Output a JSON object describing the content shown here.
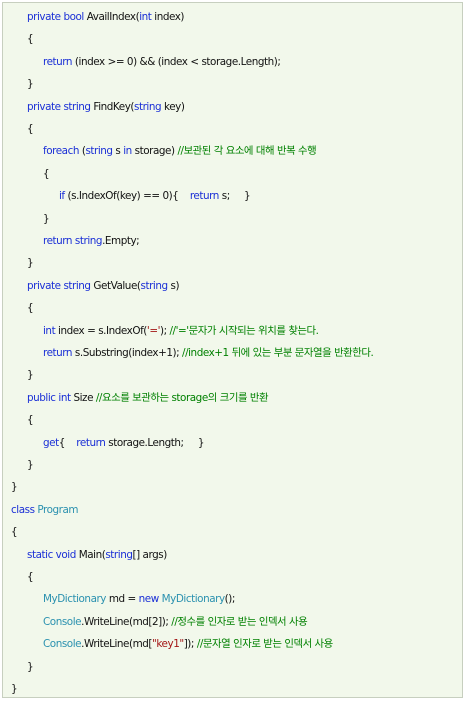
{
  "colors": {
    "background": "#f2f8eb",
    "keyword": "#1a2fd6",
    "type_name": "#2b91af",
    "string_literal": "#a31515",
    "comment": "#008000",
    "text": "#111111"
  },
  "lines": [
    {
      "indent": 1,
      "tokens": [
        {
          "c": "kw",
          "t": "private bool"
        },
        {
          "c": "txt",
          "t": " AvailIndex("
        },
        {
          "c": "kw",
          "t": "int"
        },
        {
          "c": "txt",
          "t": " index)"
        }
      ]
    },
    {
      "indent": 1,
      "tokens": [
        {
          "c": "txt",
          "t": "{"
        }
      ]
    },
    {
      "indent": 2,
      "tokens": [
        {
          "c": "kw",
          "t": "return"
        },
        {
          "c": "txt",
          "t": " (index >= 0) && (index < storage.Length);"
        }
      ]
    },
    {
      "indent": 1,
      "tokens": [
        {
          "c": "txt",
          "t": "}"
        }
      ]
    },
    {
      "indent": 1,
      "tokens": [
        {
          "c": "kw",
          "t": "private string"
        },
        {
          "c": "txt",
          "t": " FindKey("
        },
        {
          "c": "kw",
          "t": "string"
        },
        {
          "c": "txt",
          "t": " key)"
        }
      ]
    },
    {
      "indent": 1,
      "tokens": [
        {
          "c": "txt",
          "t": "{"
        }
      ]
    },
    {
      "indent": 2,
      "tokens": [
        {
          "c": "kw",
          "t": "foreach"
        },
        {
          "c": "txt",
          "t": " ("
        },
        {
          "c": "kw",
          "t": "string"
        },
        {
          "c": "txt",
          "t": " s "
        },
        {
          "c": "kw",
          "t": "in"
        },
        {
          "c": "txt",
          "t": " storage) "
        },
        {
          "c": "cmt",
          "t": "//보관된 각 요소에 대해 반복 수행"
        }
      ]
    },
    {
      "indent": 2,
      "tokens": [
        {
          "c": "txt",
          "t": "{"
        }
      ]
    },
    {
      "indent": 3,
      "tokens": [
        {
          "c": "kw",
          "t": "if"
        },
        {
          "c": "txt",
          "t": " (s.IndexOf(key) == 0){    "
        },
        {
          "c": "kw",
          "t": "return"
        },
        {
          "c": "txt",
          "t": " s;     }"
        }
      ]
    },
    {
      "indent": 2,
      "tokens": [
        {
          "c": "txt",
          "t": "}"
        }
      ]
    },
    {
      "indent": 2,
      "tokens": [
        {
          "c": "kw",
          "t": "return string"
        },
        {
          "c": "txt",
          "t": ".Empty;"
        }
      ]
    },
    {
      "indent": 1,
      "tokens": [
        {
          "c": "txt",
          "t": "}"
        }
      ]
    },
    {
      "indent": 1,
      "tokens": [
        {
          "c": "kw",
          "t": "private string"
        },
        {
          "c": "txt",
          "t": " GetValue("
        },
        {
          "c": "kw",
          "t": "string"
        },
        {
          "c": "txt",
          "t": " s)"
        }
      ]
    },
    {
      "indent": 1,
      "tokens": [
        {
          "c": "txt",
          "t": "{"
        }
      ]
    },
    {
      "indent": 2,
      "tokens": [
        {
          "c": "kw",
          "t": "int"
        },
        {
          "c": "txt",
          "t": " index = s.IndexOf("
        },
        {
          "c": "str",
          "t": "'='"
        },
        {
          "c": "txt",
          "t": "); "
        },
        {
          "c": "cmt",
          "t": "//'='문자가 시작되는 위치를 찾는다."
        }
      ]
    },
    {
      "indent": 2,
      "tokens": [
        {
          "c": "kw",
          "t": "return"
        },
        {
          "c": "txt",
          "t": " s.Substring(index+1); "
        },
        {
          "c": "cmt",
          "t": "//index+1 뒤에 있는 부분 문자열을 반환한다."
        }
      ]
    },
    {
      "indent": 1,
      "tokens": [
        {
          "c": "txt",
          "t": "}"
        }
      ]
    },
    {
      "indent": 1,
      "tokens": [
        {
          "c": "kw",
          "t": "public int"
        },
        {
          "c": "txt",
          "t": " Size "
        },
        {
          "c": "cmt",
          "t": "//요소를 보관하는 storage의 크기를 반환"
        }
      ]
    },
    {
      "indent": 1,
      "tokens": [
        {
          "c": "txt",
          "t": "{"
        }
      ]
    },
    {
      "indent": 2,
      "tokens": [
        {
          "c": "kw",
          "t": "get"
        },
        {
          "c": "txt",
          "t": "{    "
        },
        {
          "c": "kw",
          "t": "return"
        },
        {
          "c": "txt",
          "t": " storage.Length;     }"
        }
      ]
    },
    {
      "indent": 1,
      "tokens": [
        {
          "c": "txt",
          "t": "}"
        }
      ]
    },
    {
      "indent": 0,
      "tokens": [
        {
          "c": "txt",
          "t": "}"
        }
      ]
    },
    {
      "indent": 0,
      "tokens": [
        {
          "c": "kw",
          "t": "class"
        },
        {
          "c": "txt",
          "t": " "
        },
        {
          "c": "typ",
          "t": "Program"
        }
      ]
    },
    {
      "indent": 0,
      "tokens": [
        {
          "c": "txt",
          "t": "{"
        }
      ]
    },
    {
      "indent": 1,
      "tokens": [
        {
          "c": "kw",
          "t": "static void"
        },
        {
          "c": "txt",
          "t": " Main("
        },
        {
          "c": "kw",
          "t": "string"
        },
        {
          "c": "txt",
          "t": "[] args)"
        }
      ]
    },
    {
      "indent": 1,
      "tokens": [
        {
          "c": "txt",
          "t": "{"
        }
      ]
    },
    {
      "indent": 2,
      "tokens": [
        {
          "c": "typ",
          "t": "MyDictionary"
        },
        {
          "c": "txt",
          "t": " md = "
        },
        {
          "c": "kw",
          "t": "new"
        },
        {
          "c": "txt",
          "t": " "
        },
        {
          "c": "typ",
          "t": "MyDictionary"
        },
        {
          "c": "txt",
          "t": "();"
        }
      ]
    },
    {
      "indent": 2,
      "tokens": [
        {
          "c": "typ",
          "t": "Console"
        },
        {
          "c": "txt",
          "t": ".WriteLine(md[2]); "
        },
        {
          "c": "cmt",
          "t": "//정수를 인자로 받는 인덱서 사용"
        }
      ]
    },
    {
      "indent": 2,
      "tokens": [
        {
          "c": "typ",
          "t": "Console"
        },
        {
          "c": "txt",
          "t": ".WriteLine(md["
        },
        {
          "c": "str",
          "t": "\"key1\""
        },
        {
          "c": "txt",
          "t": "]); "
        },
        {
          "c": "cmt",
          "t": "//문자열 인자로 받는 인덱서 사용"
        }
      ]
    },
    {
      "indent": 1,
      "tokens": [
        {
          "c": "txt",
          "t": "}"
        }
      ]
    },
    {
      "indent": 0,
      "tokens": [
        {
          "c": "txt",
          "t": "}"
        }
      ]
    }
  ]
}
